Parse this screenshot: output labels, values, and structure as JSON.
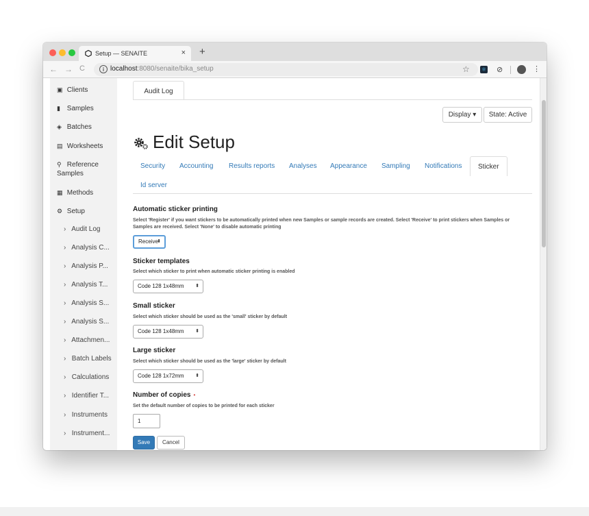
{
  "browser": {
    "tab_title": "Setup — SENAITE",
    "tab_close": "×",
    "new_tab": "+",
    "url_host": "localhost",
    "url_path": ":8080/senaite/bika_setup",
    "back": "←",
    "forward": "→",
    "reload": "C",
    "star": "☆",
    "menu": "⋮"
  },
  "sidebar": {
    "items": [
      {
        "icon": "▣",
        "label": "Clients"
      },
      {
        "icon": "▮",
        "label": "Samples"
      },
      {
        "icon": "◈",
        "label": "Batches"
      },
      {
        "icon": "▤",
        "label": "Worksheets"
      },
      {
        "icon": "⚲",
        "label": "Reference Samples"
      },
      {
        "icon": "▦",
        "label": "Methods"
      },
      {
        "icon": "⚙",
        "label": "Setup"
      }
    ],
    "subitems": [
      "Audit Log",
      "Analysis C...",
      "Analysis P...",
      "Analysis T...",
      "Analysis S...",
      "Analysis S...",
      "Attachmen...",
      "Batch Labels",
      "Calculations",
      "Identifier T...",
      "Instruments",
      "Instrument..."
    ],
    "chevron": "›"
  },
  "main": {
    "audit_tab": "Audit Log",
    "display_button": "Display ▾",
    "state_button": "State: Active",
    "title": "Edit Setup",
    "settings_tabs": [
      "Security",
      "Accounting",
      "Results reports",
      "Analyses",
      "Appearance",
      "Sampling",
      "Notifications",
      "Sticker"
    ],
    "settings_tab_row2": "Id server",
    "active_tab": "Sticker"
  },
  "form": {
    "auto_print": {
      "label": "Automatic sticker printing",
      "help": "Select 'Register' if you want stickers to be automatically printed when new Samples or sample records are created. Select 'Receive' to print stickers when Samples or Samples are received. Select 'None' to disable automatic printing",
      "value": "Receive"
    },
    "templates": {
      "label": "Sticker templates",
      "help": "Select which sticker to print when automatic sticker printing is enabled",
      "value": "Code 128 1x48mm"
    },
    "small": {
      "label": "Small sticker",
      "help": "Select which sticker should be used as the 'small' sticker by default",
      "value": "Code 128 1x48mm"
    },
    "large": {
      "label": "Large sticker",
      "help": "Select which sticker should be used as the 'large' sticker by default",
      "value": "Code 128 1x72mm"
    },
    "copies": {
      "label": "Number of copies",
      "required_mark": "•",
      "help": "Set the default number of copies to be printed for each sticker",
      "value": "1"
    },
    "save": "Save",
    "cancel": "Cancel",
    "select_arrow": "⬍"
  }
}
